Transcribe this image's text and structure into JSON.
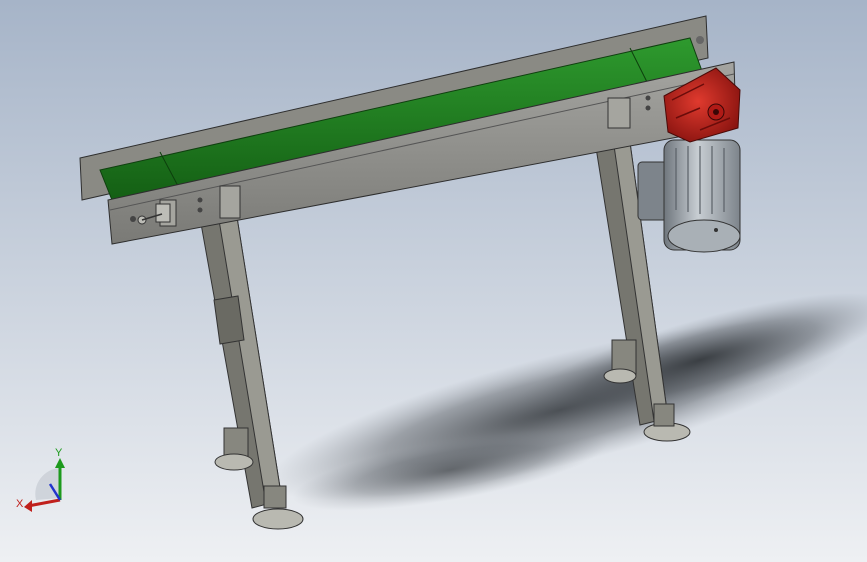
{
  "viewport": {
    "background_top": "#a6b4c8",
    "background_bottom": "#eef0f3"
  },
  "model": {
    "belt_color": "#1f7a1f",
    "frame_color": "#8e8e8e",
    "gearbox_color": "#c0201c",
    "motor_color": "#9aa2aa"
  },
  "triad": {
    "x_label": "X",
    "y_label": "Y",
    "x_color": "#c0201c",
    "y_color": "#1d9a1d",
    "z_color": "#2233cc"
  }
}
